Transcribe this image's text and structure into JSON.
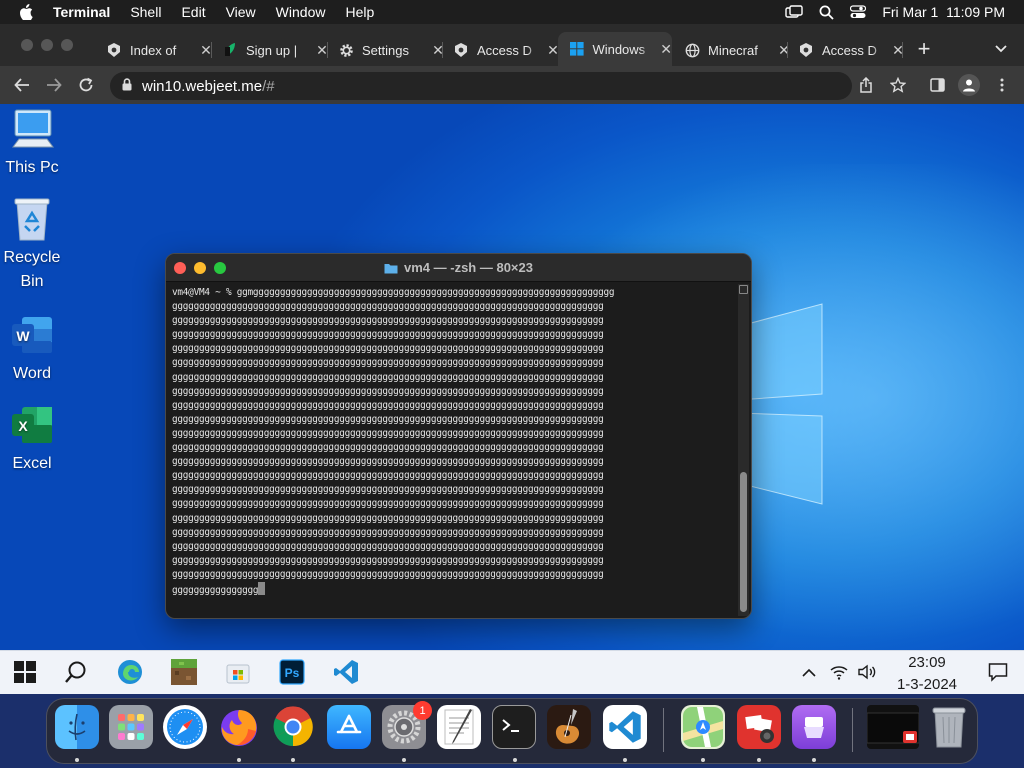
{
  "menubar": {
    "app_name": "Terminal",
    "items": [
      "Shell",
      "Edit",
      "View",
      "Window",
      "Help"
    ],
    "datetime": "Fri Mar 1  11:09 PM"
  },
  "browser": {
    "tabs": [
      {
        "label": "Index of",
        "icon": "site-icon"
      },
      {
        "label": "Sign up |",
        "icon": "leaf-icon"
      },
      {
        "label": "Settings",
        "icon": "gear-icon"
      },
      {
        "label": "Access D",
        "icon": "site-icon"
      },
      {
        "label": "Windows",
        "icon": "windows-icon"
      },
      {
        "label": "Minecraf",
        "icon": "globe-icon"
      },
      {
        "label": "Access D",
        "icon": "site-icon"
      }
    ],
    "new_tab": "+",
    "url_host": "win10.webjeet.me",
    "url_path": "/#"
  },
  "desktop": {
    "icons": [
      {
        "label": "This Pc",
        "icon": "computer-icon"
      },
      {
        "label": "Recycle Bin",
        "icon": "recycle-bin-icon"
      },
      {
        "label": "Word",
        "icon": "word-icon"
      },
      {
        "label": "Excel",
        "icon": "excel-icon"
      }
    ]
  },
  "terminal": {
    "title": "vm4 — -zsh — 80×23",
    "prompt": "vm4@VM4 ~ % ",
    "first_line": "ggmggggggggggggggggggggggggggggggggggggggggggggggggggggggggggggggggggg",
    "fill_line": "gggggggggggggggggggggggggggggggggggggggggggggggggggggggggggggggggggggggggggggggg",
    "fill_count": 20,
    "last_line": "gggggggggggggggg"
  },
  "taskbar": {
    "apps": [
      "windows-start-icon",
      "search-icon",
      "edge-icon",
      "minecraft-icon",
      "store-icon",
      "photoshop-icon",
      "vscode-icon"
    ],
    "time": "23:09",
    "date": "1-3-2024"
  },
  "dock": {
    "apps": [
      "finder-icon",
      "launchpad-icon",
      "safari-icon",
      "firefox-icon",
      "chrome-icon",
      "app-store-icon",
      "system-settings-icon",
      "textedit-icon",
      "terminal-icon",
      "garageband-icon",
      "vscode-icon",
      "maps-icon",
      "photo-booth-icon",
      "podcasts-icon",
      "screen-recording-icon",
      "trash-icon"
    ],
    "settings_badge": "1"
  }
}
